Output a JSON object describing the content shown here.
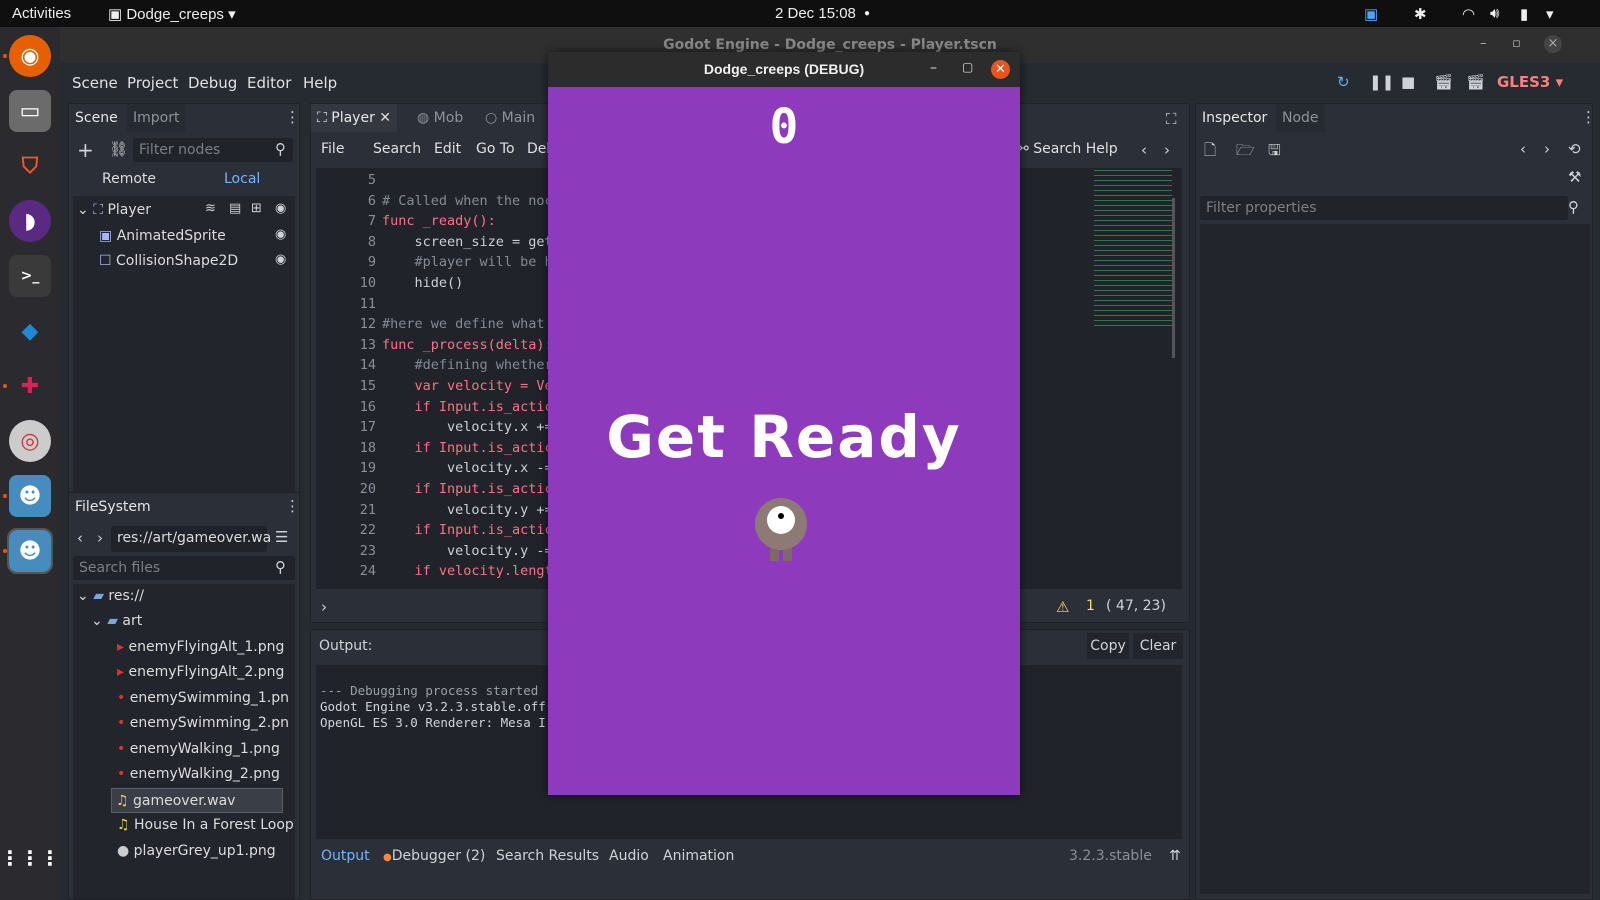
{
  "system": {
    "activities": "Activities",
    "app_name": "Dodge_creeps",
    "datetime": "2 Dec  15:08"
  },
  "editor": {
    "window_title": "Godot Engine - Dodge_creeps - Player.tscn",
    "menu": [
      "Scene",
      "Project",
      "Debug",
      "Editor",
      "Help"
    ],
    "renderer": "GLES3",
    "scene_dock": {
      "tabs": [
        "Scene",
        "Import"
      ],
      "filter_placeholder": "Filter nodes",
      "remote": "Remote",
      "local": "Local",
      "nodes": [
        "Player",
        "AnimatedSprite",
        "CollisionShape2D"
      ]
    },
    "filesystem": {
      "title": "FileSystem",
      "path": "res://art/gameover.wa",
      "search_placeholder": "Search files",
      "items": [
        "res://",
        "art",
        "enemyFlyingAlt_1.png",
        "enemyFlyingAlt_2.png",
        "enemySwimming_1.pn",
        "enemySwimming_2.pn",
        "enemyWalking_1.png",
        "enemyWalking_2.png",
        "gameover.wav",
        "House In a Forest Loop",
        "playerGrey_up1.png"
      ]
    },
    "script_tabs": [
      "Player",
      "Mob",
      "Main"
    ],
    "script_menu": [
      "File",
      "Search",
      "Edit",
      "Go To",
      "Debu"
    ],
    "search_help": "Search Help",
    "code": [
      {
        "n": "5",
        "t": ""
      },
      {
        "n": "6",
        "t": "# Called when the noc"
      },
      {
        "n": "7",
        "t": "func _ready():"
      },
      {
        "n": "8",
        "t": "    screen_size = get"
      },
      {
        "n": "9",
        "t": "    #player will be h"
      },
      {
        "n": "10",
        "t": "    hide()"
      },
      {
        "n": "11",
        "t": ""
      },
      {
        "n": "12",
        "t": "#here we define what"
      },
      {
        "n": "13",
        "t": "func _process(delta):"
      },
      {
        "n": "14",
        "t": "    #defining whether"
      },
      {
        "n": "15",
        "t": "    var velocity = Ve"
      },
      {
        "n": "16",
        "t": "    if Input.is_actic"
      },
      {
        "n": "17",
        "t": "        velocity.x +="
      },
      {
        "n": "18",
        "t": "    if Input.is_actic"
      },
      {
        "n": "19",
        "t": "        velocity.x -="
      },
      {
        "n": "20",
        "t": "    if Input.is_actic"
      },
      {
        "n": "21",
        "t": "        velocity.y +="
      },
      {
        "n": "22",
        "t": "    if Input.is_actic"
      },
      {
        "n": "23",
        "t": "        velocity.y -="
      },
      {
        "n": "24",
        "t": "    if velocity.lengt"
      }
    ],
    "warnings": "1",
    "cursor_pos": "( 47, 23)",
    "output": {
      "title": "Output:",
      "copy": "Copy",
      "clear": "Clear",
      "lines": [
        "--- Debugging process started",
        "Godot Engine v3.2.3.stable.off",
        "OpenGL ES 3.0 Renderer: Mesa I"
      ]
    },
    "bottom_tabs": [
      "Output",
      "Debugger (2)",
      "Search Results",
      "Audio",
      "Animation"
    ],
    "version": "3.2.3.stable",
    "inspector": {
      "tabs": [
        "Inspector",
        "Node"
      ],
      "filter_placeholder": "Filter properties"
    }
  },
  "game": {
    "title": "Dodge_creeps (DEBUG)",
    "score": "0",
    "message": "Get Ready",
    "bg_color": "#8e3abd"
  }
}
